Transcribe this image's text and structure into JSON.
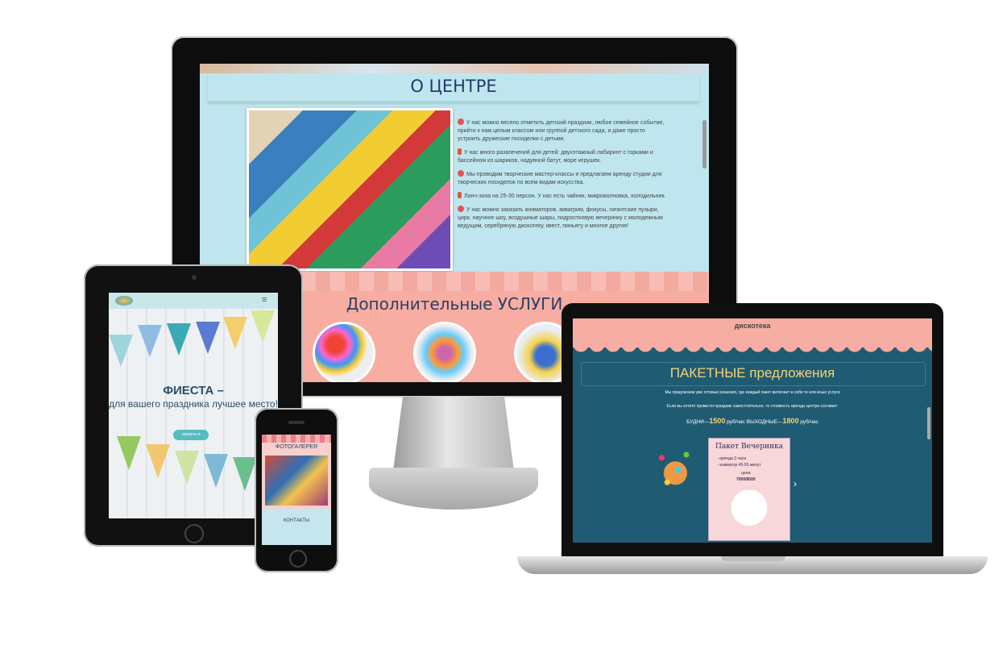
{
  "monitor": {
    "about_title": "О ЦЕНТРЕ",
    "about_paragraphs": [
      "У нас можно весело отметить детский праздник, любое семейное событие, прийти к нам целым классом или группой детского сада, и даже просто устроить дружеские посиделки с детьми.",
      "У нас много развлечений для детей: двухэтажный лабиринт с горками и бассейном из шариков, надувной батут, море игрушек.",
      "Мы проводим творческие мастер-классы и предлагаем аренду студии для творческих посиделок по всем видам искусства.",
      "Ланч-зона на 25-30 персон. У нас есть чайник, микроволновка, холодильник.",
      "У нас можно заказать аниматоров, аквагрим, фокусы, гигантские пузыри, цирк, научное шоу, воздушные шары, подростковую вечеринку с молодежным ведущим, серебряную дискотеку, квест, пиньяту и многое другое!"
    ],
    "services_title": "Дополнительные УСЛУГИ"
  },
  "tablet": {
    "hero_title": "ФИЕСТА –",
    "hero_subtitle": "для вашего праздника лучшее место!",
    "hero_button": "связаться"
  },
  "phone": {
    "gallery_title": "ФОТОГАЛЕРЕЯ",
    "contacts_title": "КОНТАКТЫ"
  },
  "laptop": {
    "disco_label": "дискотека",
    "packages_title": "ПАКЕТНЫЕ предложения",
    "line1": "Мы предлагаем уже готовые решения, где каждый пакет включает в себя те или иные услуги",
    "line2": "Если вы хотите провести праздник самостоятельно, то стоимость аренды центра составит:",
    "price_weekday_label": "БУДНИ—",
    "price_weekday_value": "1500",
    "price_unit1": "руб/час",
    "price_weekend_label": "ВЫХОДНЫЕ—",
    "price_weekend_value": "1800",
    "price_unit2": "руб/час",
    "card_title": "Пакет Вечеринка",
    "card_line1": "- аренда 3 часа",
    "card_line2": "- аниматор 45-55 минут",
    "card_price_label": "цена:",
    "card_price": "7000/8000",
    "next_arrow": "›"
  },
  "colors": {
    "monitor_bg": "#bfe6ee",
    "services_bg": "#f7ada2",
    "laptop_bg": "#1f5b73",
    "accent_gold": "#f4d27a"
  }
}
